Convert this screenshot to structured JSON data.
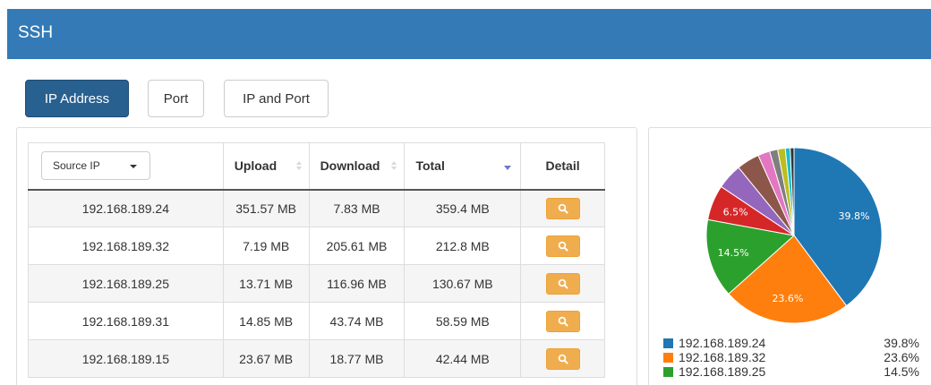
{
  "header": {
    "title": "SSH"
  },
  "buttons": {
    "ip_address": "IP Address",
    "port": "Port",
    "ip_and_port": "IP and Port"
  },
  "table": {
    "filter_select": "Source IP",
    "columns": {
      "upload": "Upload",
      "download": "Download",
      "total": "Total",
      "detail": "Detail"
    },
    "rows": [
      {
        "ip": "192.168.189.24",
        "upload": "351.57 MB",
        "download": "7.83 MB",
        "total": "359.4 MB"
      },
      {
        "ip": "192.168.189.32",
        "upload": "7.19 MB",
        "download": "205.61 MB",
        "total": "212.8 MB"
      },
      {
        "ip": "192.168.189.25",
        "upload": "13.71 MB",
        "download": "116.96 MB",
        "total": "130.67 MB"
      },
      {
        "ip": "192.168.189.31",
        "upload": "14.85 MB",
        "download": "43.74 MB",
        "total": "58.59 MB"
      },
      {
        "ip": "192.168.189.15",
        "upload": "23.67 MB",
        "download": "18.77 MB",
        "total": "42.44 MB"
      }
    ]
  },
  "chart_data": {
    "type": "pie",
    "slices": [
      {
        "label": "192.168.189.24",
        "value": 39.8,
        "color": "#1f77b4",
        "show_label": true,
        "label_text": "39.8%"
      },
      {
        "label": "192.168.189.32",
        "value": 23.6,
        "color": "#ff7f0e",
        "show_label": true,
        "label_text": "23.6%"
      },
      {
        "label": "192.168.189.25",
        "value": 14.5,
        "color": "#2ca02c",
        "show_label": true,
        "label_text": "14.5%"
      },
      {
        "label": "",
        "value": 6.5,
        "color": "#d62728",
        "show_label": true,
        "label_text": "6.5%"
      },
      {
        "label": "",
        "value": 4.7,
        "color": "#9467bd",
        "show_label": false
      },
      {
        "label": "",
        "value": 4.2,
        "color": "#8c564b",
        "show_label": false
      },
      {
        "label": "",
        "value": 2.2,
        "color": "#e377c2",
        "show_label": false
      },
      {
        "label": "",
        "value": 1.5,
        "color": "#7f7f7f",
        "show_label": false
      },
      {
        "label": "",
        "value": 1.4,
        "color": "#bcbd22",
        "show_label": false
      },
      {
        "label": "",
        "value": 0.9,
        "color": "#17becf",
        "show_label": false
      },
      {
        "label": "",
        "value": 0.7,
        "color": "#333333",
        "show_label": false
      }
    ],
    "legend": [
      {
        "label": "192.168.189.24",
        "pct": "39.8%",
        "color": "#1f77b4"
      },
      {
        "label": "192.168.189.32",
        "pct": "23.6%",
        "color": "#ff7f0e"
      },
      {
        "label": "192.168.189.25",
        "pct": "14.5%",
        "color": "#2ca02c"
      }
    ]
  },
  "colors": {
    "header": "#337ab7",
    "primary_button": "#286090",
    "detail_button": "#f0ad4e"
  },
  "icons": {
    "detail": "search-icon",
    "sort": "sort-icon"
  }
}
